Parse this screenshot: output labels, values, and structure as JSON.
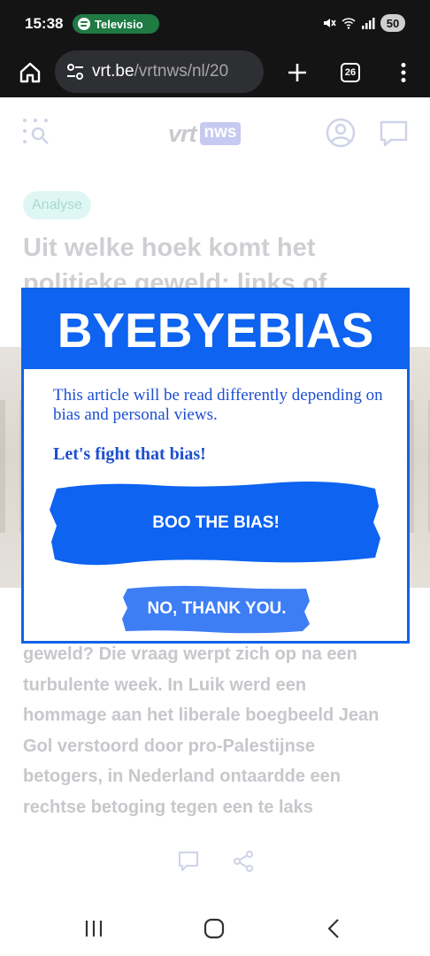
{
  "status_bar": {
    "time": "15:38",
    "media_app": "Televisio",
    "battery": "50",
    "icons": [
      "mute-icon",
      "wifi-icon",
      "signal-icon",
      "spotify-icon"
    ]
  },
  "browser": {
    "url_host": "vrt.be",
    "url_path": "/vrtnws/nl/20",
    "tab_count": "26",
    "icons": [
      "home-icon",
      "site-settings-icon",
      "plus-icon",
      "more-vert-icon"
    ]
  },
  "page": {
    "logo_main": "vrt",
    "logo_badge": "nws",
    "tag": "Analyse",
    "headline": "Uit welke hoek komt het politieke geweld: links of",
    "body": "geweld? Die vraag werpt zich op na een turbulente week. In Luik werd een hommage aan het liberale boegbeeld Jean Gol verstoord door pro-Palestijnse betogers, in Nederland ontaardde een rechtse betoging tegen een te laks"
  },
  "popup": {
    "title": "BYEBYEBIAS",
    "message": "This article will be read differently depending on bias and personal views.",
    "cta_text": "Let's fight that bias!",
    "primary_button": "BOO THE BIAS!",
    "secondary_button": "NO, THANK YOU.",
    "colors": {
      "brand_blue": "#0e63f0",
      "text_blue": "#1d4fd0",
      "secondary_blue": "#3d7ef5"
    }
  },
  "navbar": {
    "icons": [
      "recent-apps-icon",
      "home-icon",
      "back-icon"
    ]
  }
}
